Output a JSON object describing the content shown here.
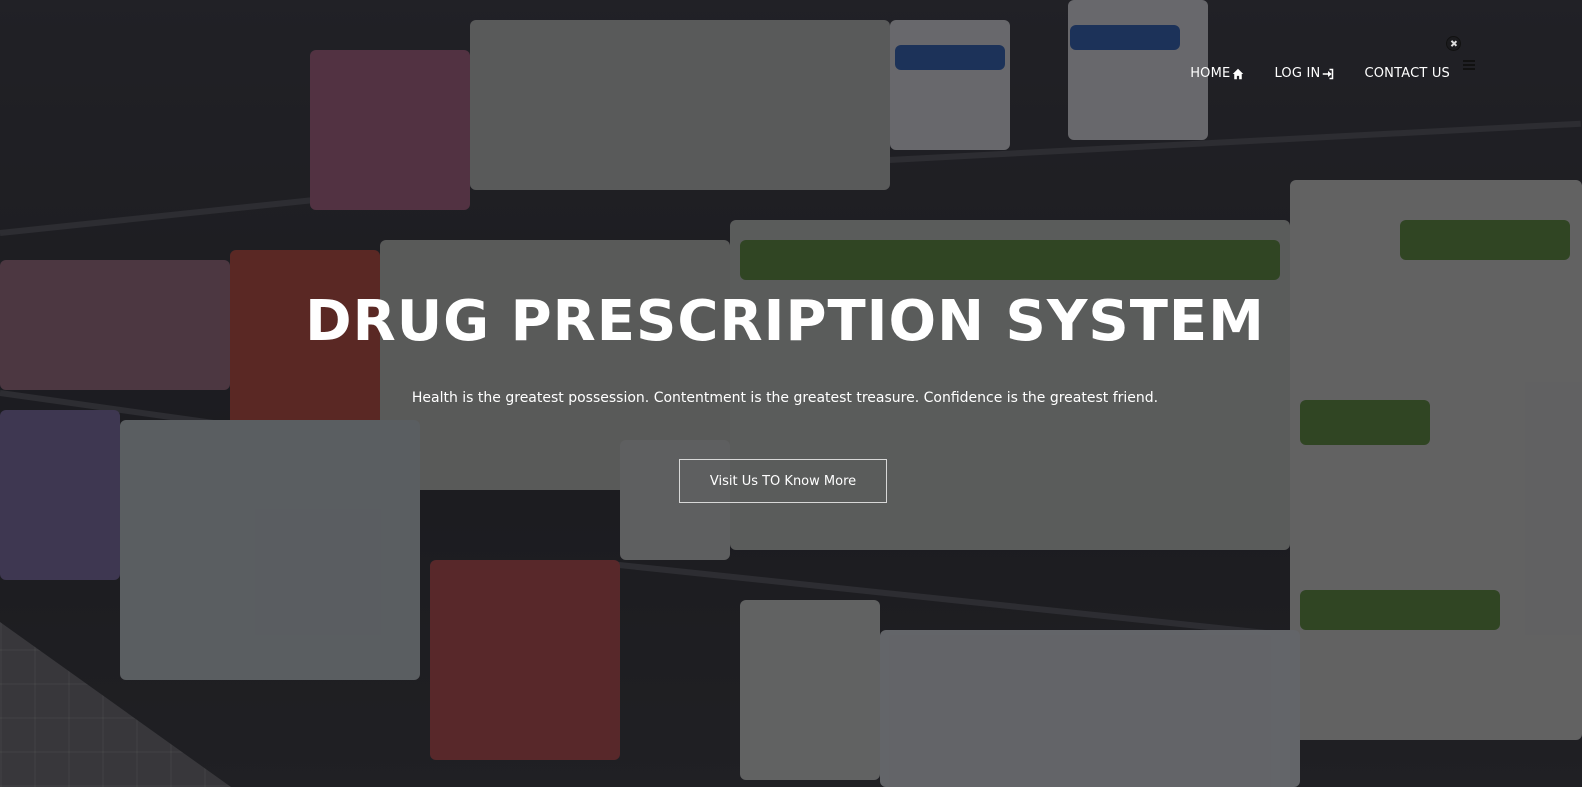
{
  "nav": {
    "items": [
      {
        "label": "HOME",
        "icon": "home-icon"
      },
      {
        "label": "LOG IN",
        "icon": "login-icon"
      },
      {
        "label": "CONTACT US",
        "icon": ""
      }
    ],
    "close_icon": "close-icon",
    "menu_icon": "hamburger-menu-icon"
  },
  "hero": {
    "title": "DRUG PRESCRIPTION SYSTEM",
    "subtitle": "Health is the greatest possession. Contentment is the greatest treasure. Confidence is the greatest friend.",
    "cta_label": "Visit Us TO Know More"
  },
  "colors": {
    "overlay": "#0c0c10",
    "text": "#ffffff",
    "cta_border": "#d8d8d8"
  }
}
